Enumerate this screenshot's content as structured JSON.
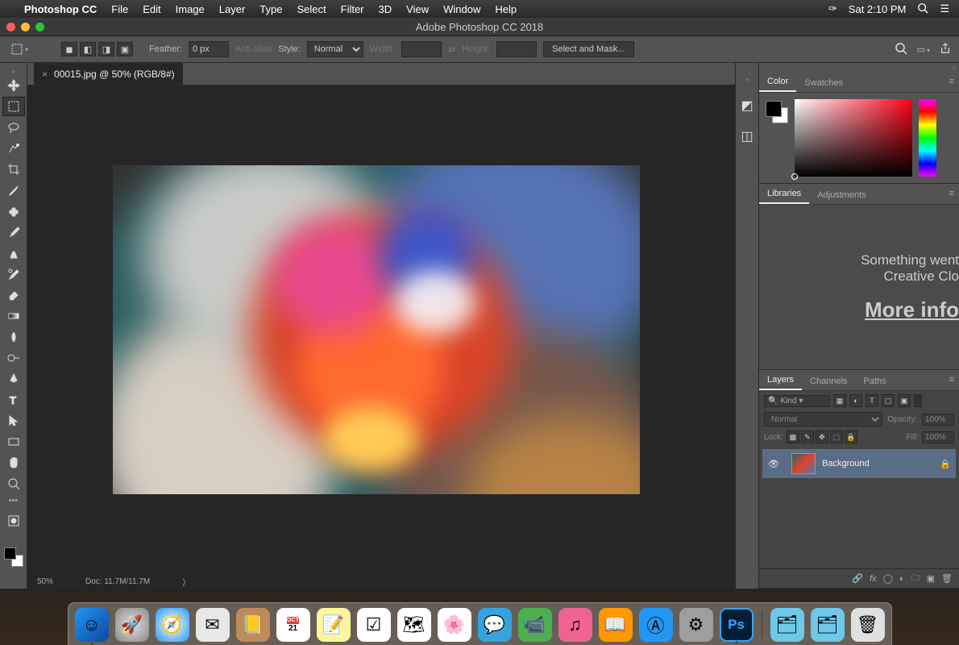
{
  "menubar": {
    "app": "Photoshop CC",
    "items": [
      "File",
      "Edit",
      "Image",
      "Layer",
      "Type",
      "Select",
      "Filter",
      "3D",
      "View",
      "Window",
      "Help"
    ],
    "datetime": "Sat 2:10 PM"
  },
  "window": {
    "title": "Adobe Photoshop CC 2018"
  },
  "options": {
    "feather_label": "Feather:",
    "feather_value": "0 px",
    "antialias": "Anti-alias",
    "style_label": "Style:",
    "style_value": "Normal",
    "width_label": "Width:",
    "height_label": "Height:",
    "mask_btn": "Select and Mask..."
  },
  "document": {
    "tab": "00015.jpg @ 50% (RGB/8#)",
    "zoom": "50%",
    "doc_info": "Doc: 11.7M/11.7M"
  },
  "panels": {
    "color_tab": "Color",
    "swatches_tab": "Swatches",
    "libraries_tab": "Libraries",
    "adjustments_tab": "Adjustments",
    "lib_msg_line1": "Something went",
    "lib_msg_line2": "Creative Clo",
    "lib_more": "More info",
    "layers_tab": "Layers",
    "channels_tab": "Channels",
    "paths_tab": "Paths",
    "filter_kind": "Kind",
    "mode_normal": "Normal",
    "opacity_label": "Opacity:",
    "opacity_value": "100%",
    "lock_label": "Lock:",
    "fill_label": "Fill:",
    "fill_value": "100%",
    "bg_layer": "Background"
  },
  "dock": {
    "calendar_month": "OCT",
    "calendar_day": "21",
    "ps_label": "Ps"
  }
}
